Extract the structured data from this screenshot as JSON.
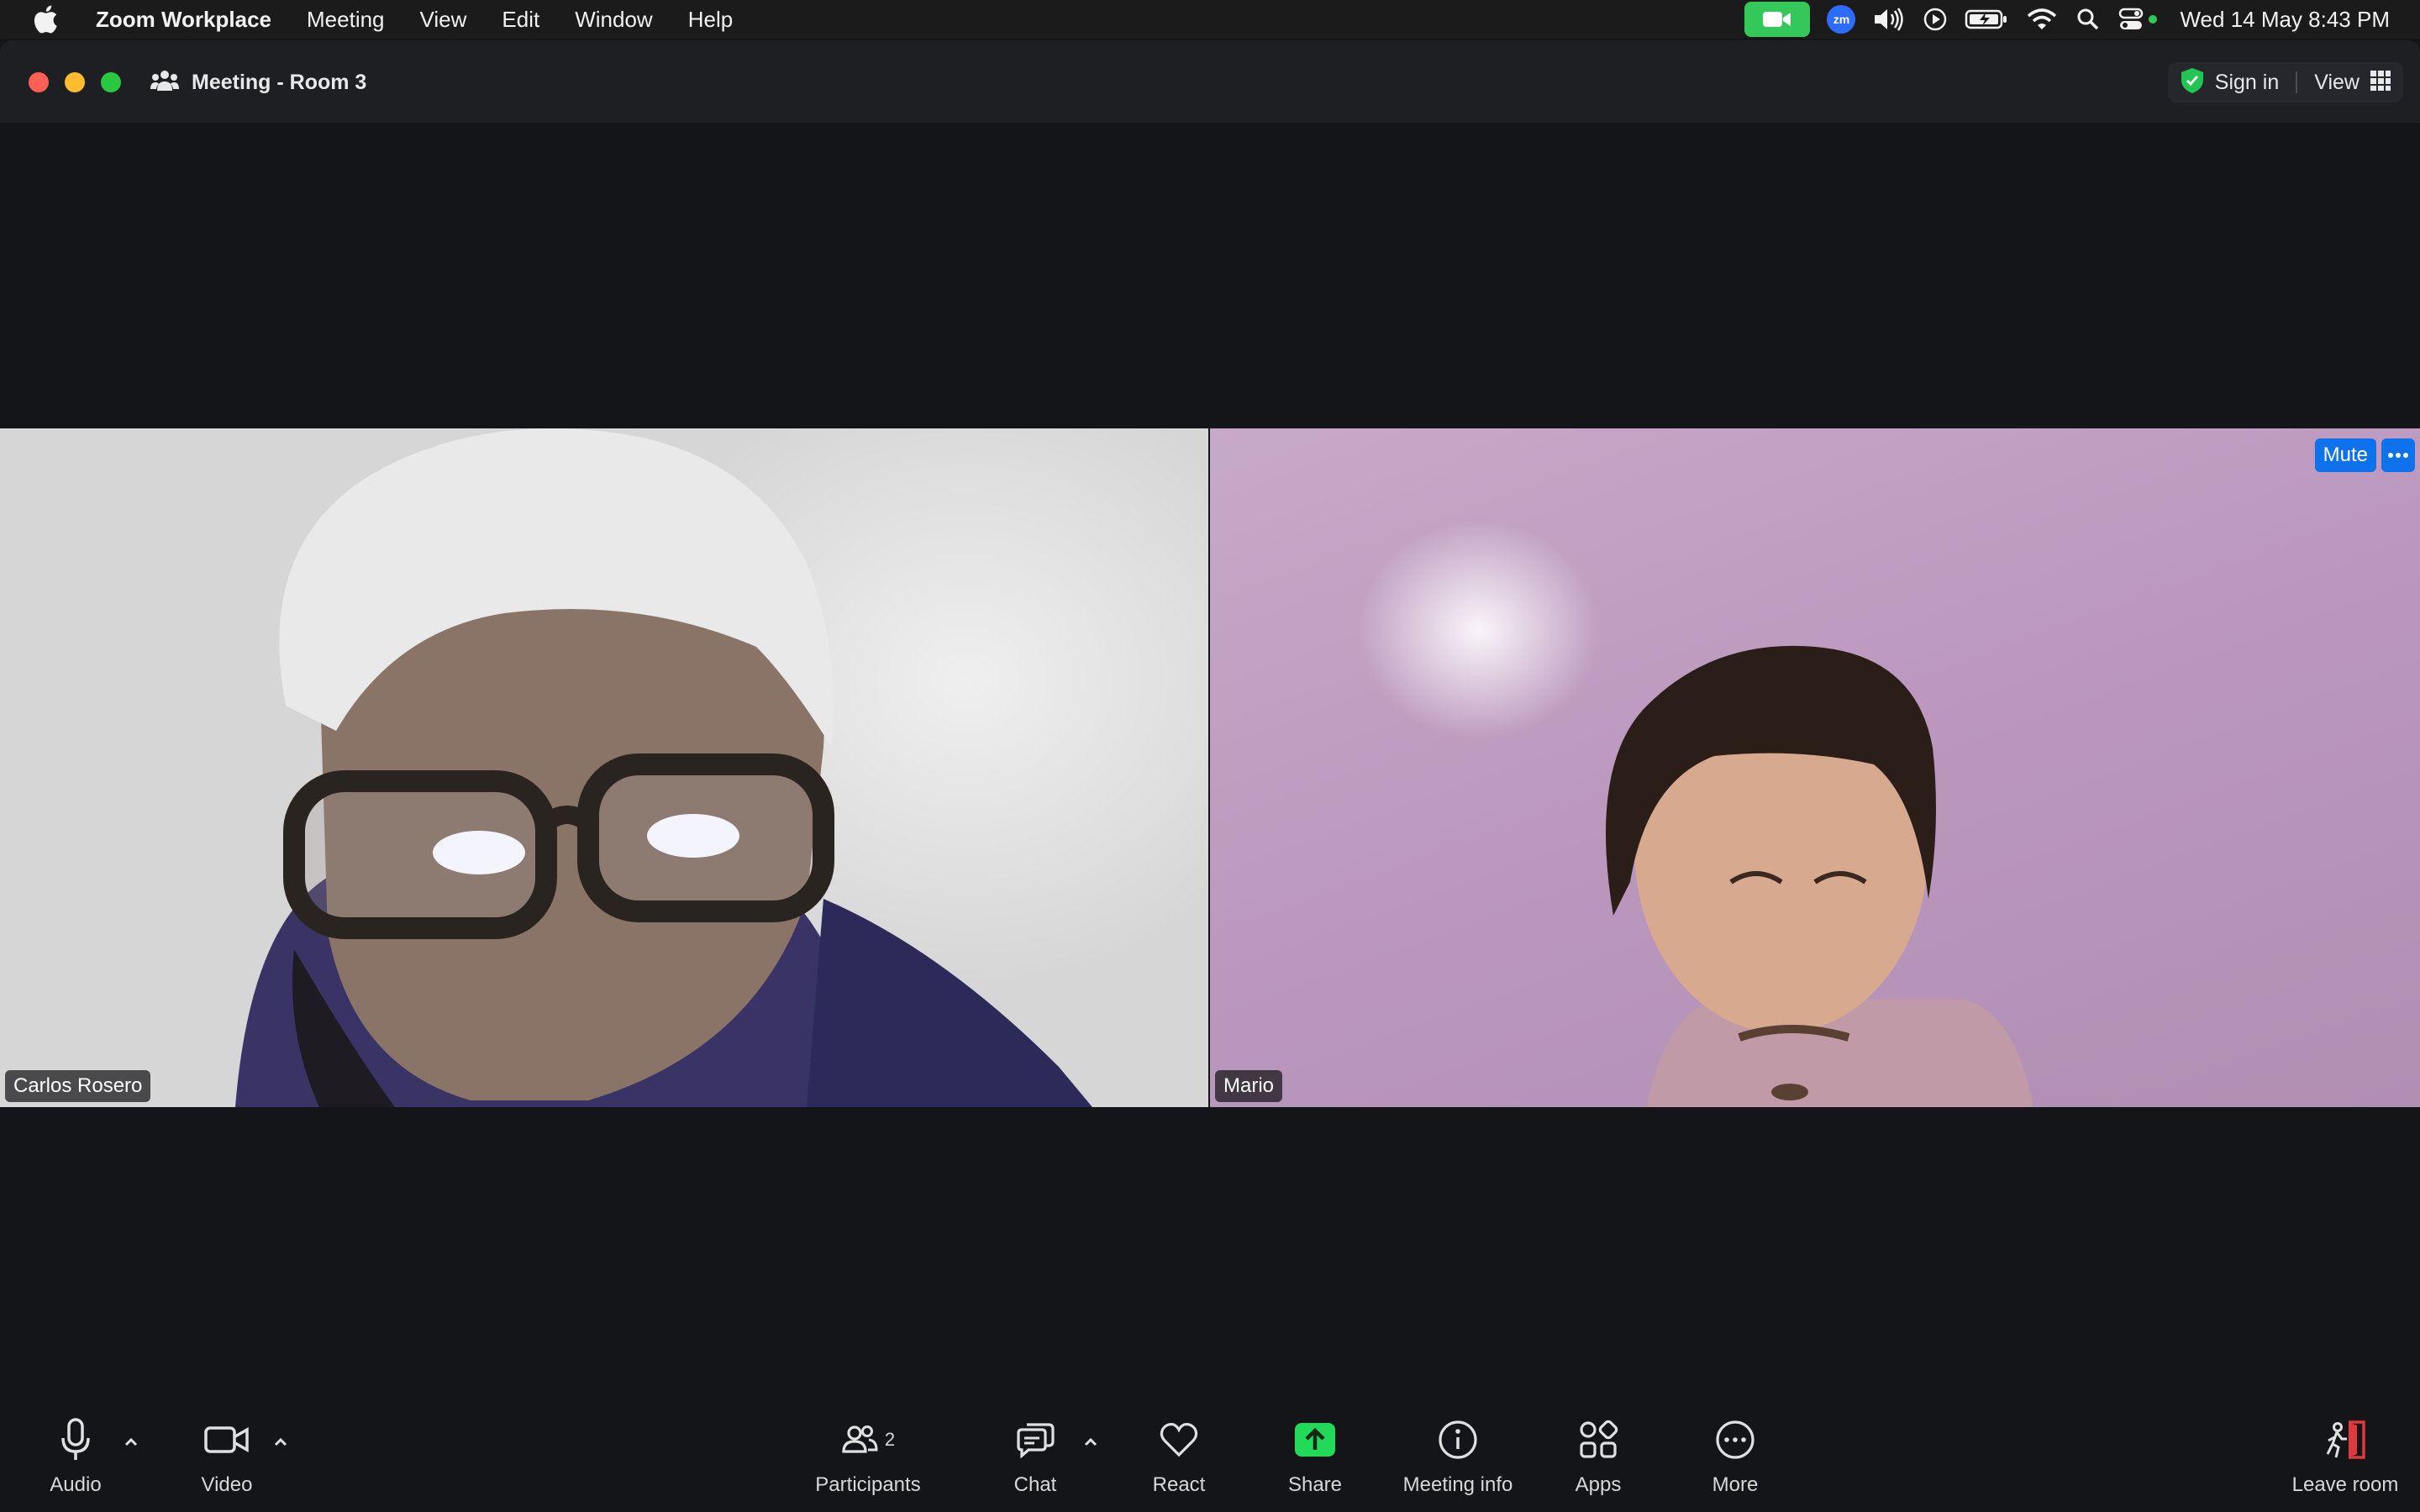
{
  "menubar": {
    "app_name": "Zoom Workplace",
    "items": [
      "Meeting",
      "View",
      "Edit",
      "Window",
      "Help"
    ],
    "zm_badge": "zm",
    "clock": "Wed 14 May  8:43 PM",
    "icons": [
      "apple-icon",
      "zoom-video-status-icon",
      "zoom-badge-icon",
      "volume-icon",
      "play-icon",
      "battery-icon",
      "wifi-icon",
      "search-icon",
      "control-center-icon"
    ]
  },
  "window": {
    "title": "Meeting - Room 3",
    "sign_in": "Sign in",
    "view": "View"
  },
  "participants": [
    {
      "name": "Carlos Rosero"
    },
    {
      "name": "Mario",
      "mute_label": "Mute"
    }
  ],
  "toolbar": {
    "audio": "Audio",
    "video": "Video",
    "participants": "Participants",
    "participants_count": "2",
    "chat": "Chat",
    "react": "React",
    "share": "Share",
    "meeting_info": "Meeting info",
    "apps": "Apps",
    "more": "More",
    "leave": "Leave room"
  },
  "colors": {
    "background": "#131519",
    "accent": "#0e72ed",
    "share_green": "#23d959",
    "leave_red": "#e0383e"
  }
}
